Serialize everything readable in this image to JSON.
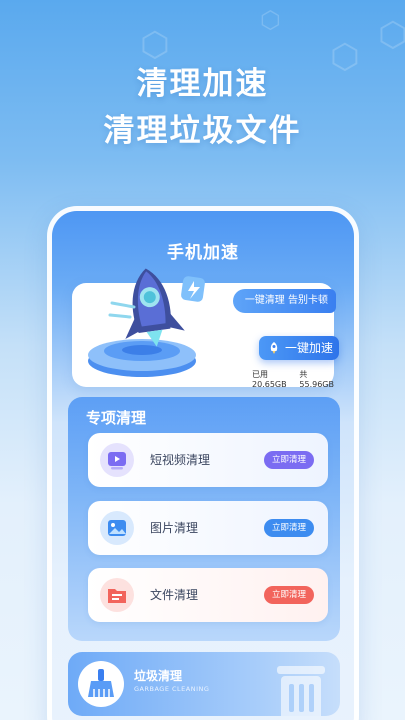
{
  "headline": {
    "line1": "清理加速",
    "line2": "清理垃圾文件"
  },
  "app": {
    "title": "手机加速"
  },
  "boost_card": {
    "tagline": "一键清理 告别卡顿",
    "button_label": "一键加速",
    "used": "已用20.65GB",
    "total": "共55.96GB"
  },
  "special_clean": {
    "title": "专项清理",
    "items": [
      {
        "label": "短视频清理",
        "action": "立即清理",
        "icon": "video-icon",
        "icon_color": "#7b6cf2"
      },
      {
        "label": "图片清理",
        "action": "立即清理",
        "icon": "image-icon",
        "icon_color": "#3d8cf0"
      },
      {
        "label": "文件清理",
        "action": "立即清理",
        "icon": "folder-icon",
        "icon_color": "#f2645c"
      }
    ]
  },
  "garbage_clean": {
    "title": "垃圾清理",
    "subtitle": "GARBAGE CLEANING",
    "icon": "broom-icon"
  },
  "colors": {
    "accent": "#3a7ff0",
    "video_button": "#7b6cf2",
    "image_button": "#3d8cf0",
    "file_button": "#f2645c"
  }
}
